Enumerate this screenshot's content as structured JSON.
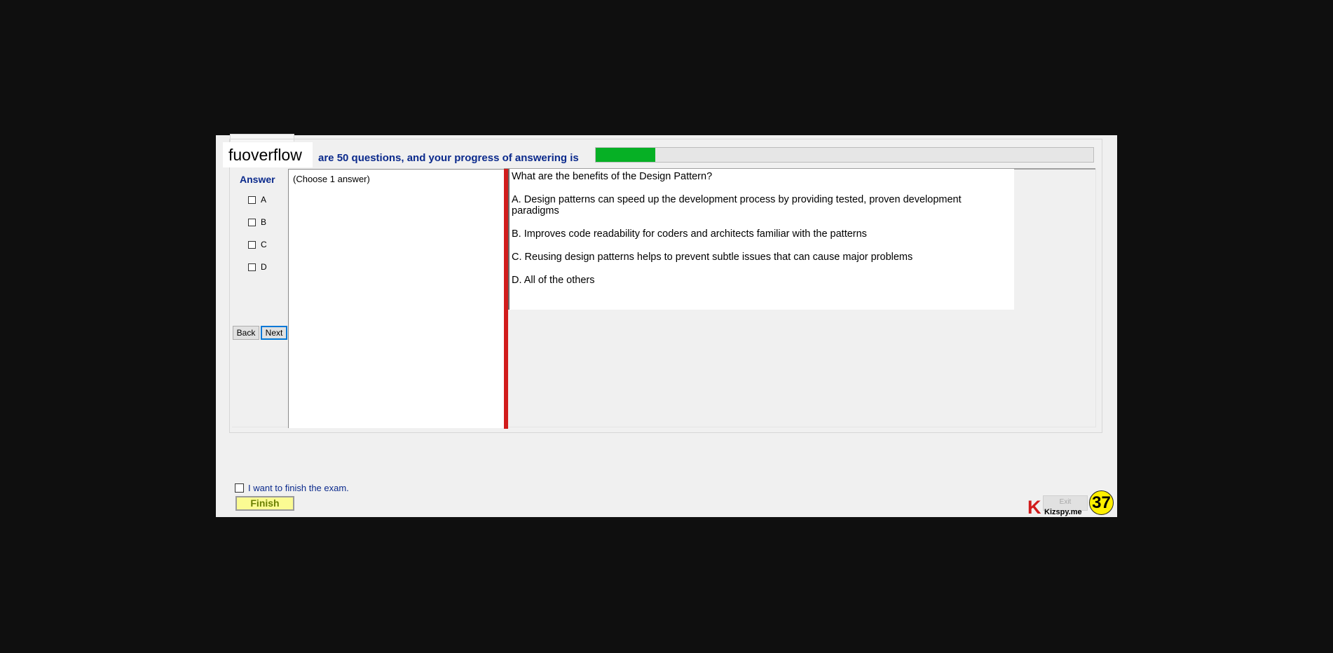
{
  "header": {
    "brand": "fuoverflow",
    "progress_text": "are 50 questions, and your progress of answering is",
    "progress_fraction": 0.12,
    "progress_color": "#06b025"
  },
  "answer_panel": {
    "title": "Answer",
    "options": [
      "A",
      "B",
      "C",
      "D"
    ],
    "back_label": "Back",
    "next_label": "Next"
  },
  "choose_panel": {
    "text": "(Choose 1 answer)"
  },
  "question": {
    "prompt": "What are the benefits of the Design Pattern?",
    "choices": [
      "A.  Design patterns can speed up the development process by providing tested, proven development paradigms",
      "B.  Improves code readability for coders and architects familiar with the patterns",
      "C.  Reusing design patterns helps to prevent subtle issues that can cause major problems",
      "D.  All of the others"
    ]
  },
  "footer": {
    "finish_checkbox_label": "I want to finish the exam.",
    "finish_label": "Finish",
    "exit_label": "Exit",
    "logo_letter": "K",
    "logo_text": "Kizspy.me",
    "count_badge": "37"
  }
}
